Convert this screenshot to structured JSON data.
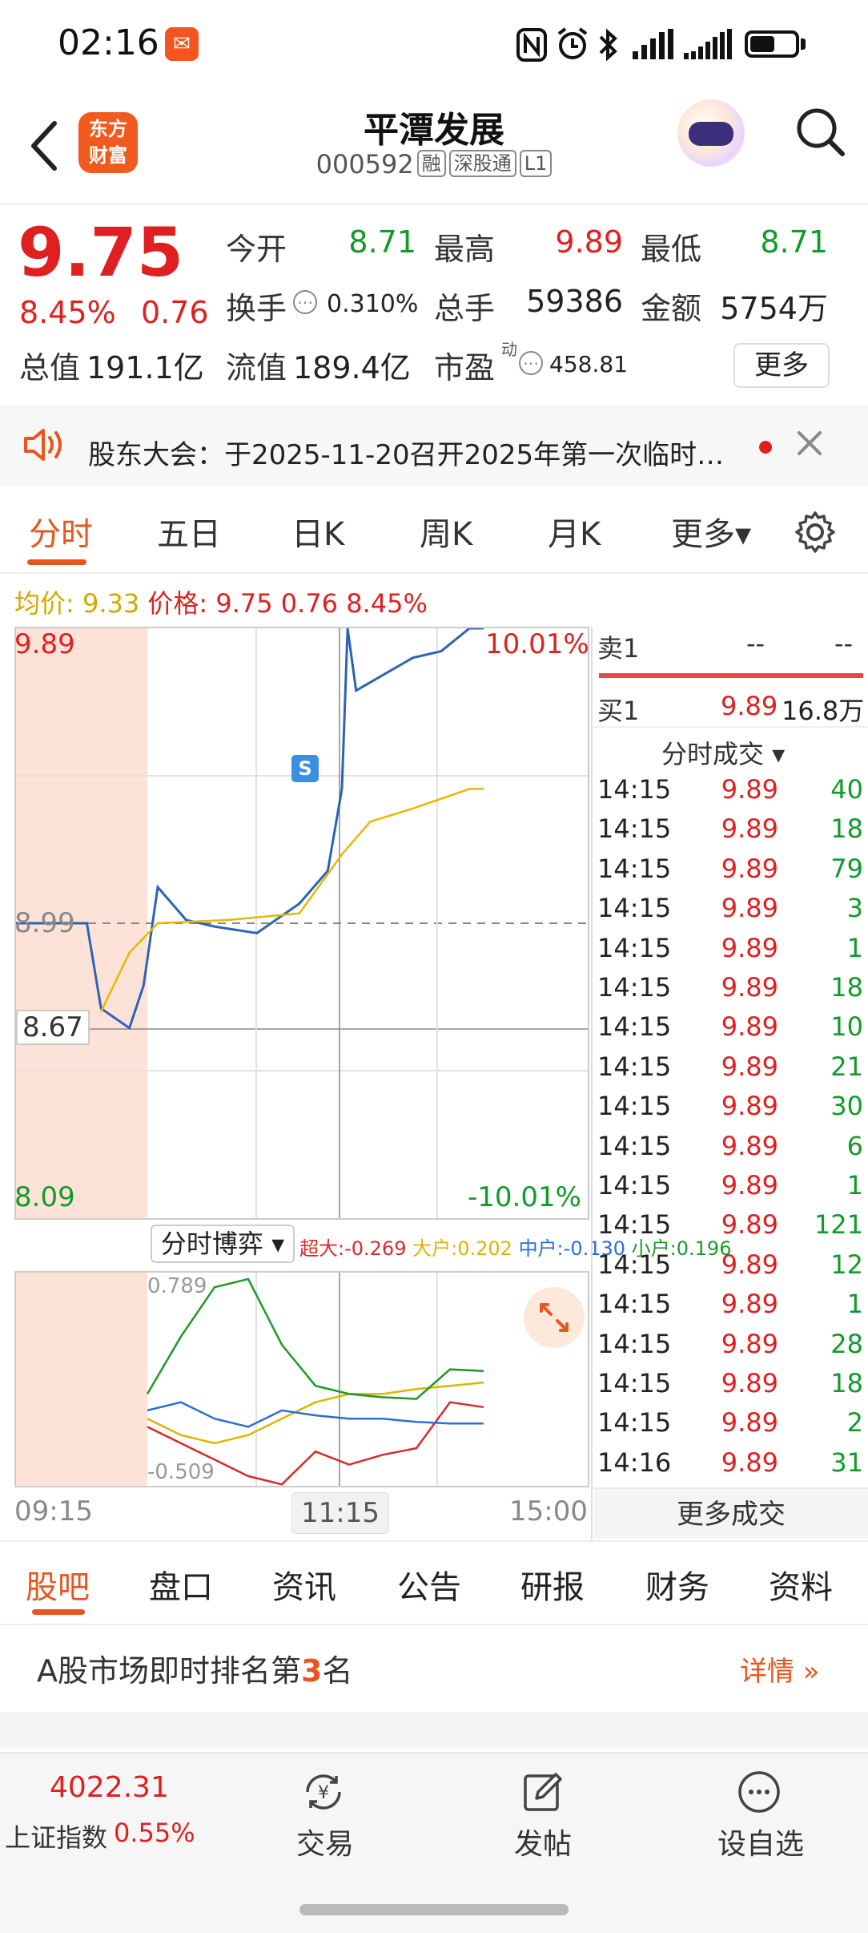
{
  "status_bar": {
    "time": "02:16",
    "icons": [
      "app-notification-icon",
      "nfc-icon",
      "alarm-icon",
      "bluetooth-icon",
      "signal-icon",
      "signal-icon-2",
      "battery-icon"
    ]
  },
  "header": {
    "app_logo_line1": "东方",
    "app_logo_line2": "财富",
    "stock_name": "平潭发展",
    "stock_code": "000592",
    "tags": [
      "融",
      "深股通",
      "L1"
    ]
  },
  "quote": {
    "price": "9.75",
    "change_pct": "8.45%",
    "change_amt": "0.76",
    "fields": {
      "open_label": "今开",
      "open_value": "8.71",
      "high_label": "最高",
      "high_value": "9.89",
      "low_label": "最低",
      "low_value": "8.71",
      "turnover_label": "换手",
      "turnover_value": "0.310%",
      "volume_label": "总手",
      "volume_value": "59386",
      "amount_label": "金额",
      "amount_value": "5754万",
      "mktcap_label": "总值",
      "mktcap_value": "191.1亿",
      "float_label": "流值",
      "float_value": "189.4亿",
      "pe_label": "市盈",
      "pe_sup": "动",
      "pe_value": "458.81"
    },
    "more_button": "更多"
  },
  "notice": {
    "text": "股东大会：于2025-11-20召开2025年第一次临时…"
  },
  "chart_tabs": {
    "tabs": [
      "分时",
      "五日",
      "日K",
      "周K",
      "月K",
      "更多▾"
    ],
    "active": 0
  },
  "intraday": {
    "avg_label": "均价:",
    "avg_value": "9.33",
    "price_label": "价格:",
    "price_value": "9.75 0.76 8.45%",
    "y_top": "9.89",
    "y_mid": "8.99",
    "y_cursor": "8.67",
    "y_bottom": "8.09",
    "pct_top": "10.01%",
    "pct_bottom": "-10.01%",
    "signal_marker": "S",
    "sub_select": "分时博弈",
    "flow_legend": [
      {
        "label": "超大:",
        "value": "-0.269",
        "color": "#d62b2b"
      },
      {
        "label": "大户:",
        "value": "0.202",
        "color": "#e0b400"
      },
      {
        "label": "中户:",
        "value": "-0.130",
        "color": "#2a6fd6"
      },
      {
        "label": "小户:",
        "value": "0.196",
        "color": "#1c9a2a"
      }
    ],
    "sub_top": "0.789",
    "sub_bottom": "-0.509",
    "time_start": "09:15",
    "time_mid": "11:15",
    "time_end": "15:00"
  },
  "chart_data": [
    {
      "type": "line",
      "title": "",
      "x_range": [
        "09:15",
        "15:00"
      ],
      "ylim": [
        8.09,
        9.89
      ],
      "reference_price": 8.99,
      "series": [
        {
          "name": "价格",
          "color": "#2b63b8",
          "x": [
            "09:15",
            "09:30",
            "09:40",
            "09:45",
            "09:55",
            "10:00",
            "10:05",
            "10:15",
            "10:25",
            "10:40",
            "10:55",
            "11:05",
            "11:10",
            "11:12",
            "11:15",
            "11:25",
            "11:35",
            "11:45",
            "11:55",
            "12:00"
          ],
          "values": [
            8.99,
            8.99,
            8.99,
            8.73,
            8.67,
            8.8,
            9.1,
            9.0,
            8.98,
            8.96,
            9.05,
            9.15,
            9.4,
            9.89,
            9.7,
            9.75,
            9.8,
            9.82,
            9.89,
            9.89
          ]
        },
        {
          "name": "均价",
          "color": "#e6b800",
          "x": [
            "09:45",
            "09:55",
            "10:05",
            "10:30",
            "10:55",
            "11:10",
            "11:20",
            "11:35",
            "11:55",
            "12:00"
          ],
          "values": [
            8.72,
            8.9,
            8.99,
            9.0,
            9.02,
            9.2,
            9.3,
            9.34,
            9.4,
            9.4
          ]
        }
      ]
    },
    {
      "type": "line",
      "title": "分时博弈",
      "ylim": [
        -0.509,
        0.789
      ],
      "series": [
        {
          "name": "超大",
          "color": "#d62b2b",
          "values": [
            -0.15,
            -0.25,
            -0.35,
            -0.45,
            -0.5,
            -0.3,
            -0.38,
            -0.32,
            -0.28,
            0.0,
            -0.03
          ]
        },
        {
          "name": "大户",
          "color": "#e0b400",
          "values": [
            -0.1,
            -0.2,
            -0.25,
            -0.2,
            -0.1,
            0.0,
            0.05,
            0.05,
            0.08,
            0.1,
            0.12
          ]
        },
        {
          "name": "中户",
          "color": "#2a6fd6",
          "values": [
            -0.05,
            0.0,
            -0.1,
            -0.15,
            -0.05,
            -0.08,
            -0.1,
            -0.1,
            -0.12,
            -0.13,
            -0.13
          ]
        },
        {
          "name": "小户",
          "color": "#1c9a2a",
          "values": [
            0.05,
            0.4,
            0.7,
            0.75,
            0.35,
            0.1,
            0.05,
            0.03,
            0.02,
            0.2,
            0.19
          ]
        }
      ]
    }
  ],
  "order_book": {
    "sell1_label": "卖1",
    "sell1_price": "--",
    "sell1_vol": "--",
    "buy1_label": "买1",
    "buy1_price": "9.89",
    "buy1_vol": "16.8万"
  },
  "ticks": {
    "title": "分时成交 ▾",
    "rows": [
      {
        "time": "14:15",
        "price": "9.89",
        "vol": "40"
      },
      {
        "time": "14:15",
        "price": "9.89",
        "vol": "18"
      },
      {
        "time": "14:15",
        "price": "9.89",
        "vol": "79"
      },
      {
        "time": "14:15",
        "price": "9.89",
        "vol": "3"
      },
      {
        "time": "14:15",
        "price": "9.89",
        "vol": "1"
      },
      {
        "time": "14:15",
        "price": "9.89",
        "vol": "18"
      },
      {
        "time": "14:15",
        "price": "9.89",
        "vol": "10"
      },
      {
        "time": "14:15",
        "price": "9.89",
        "vol": "21"
      },
      {
        "time": "14:15",
        "price": "9.89",
        "vol": "30"
      },
      {
        "time": "14:15",
        "price": "9.89",
        "vol": "6"
      },
      {
        "time": "14:15",
        "price": "9.89",
        "vol": "1"
      },
      {
        "time": "14:15",
        "price": "9.89",
        "vol": "121"
      },
      {
        "time": "14:15",
        "price": "9.89",
        "vol": "12"
      },
      {
        "time": "14:15",
        "price": "9.89",
        "vol": "1"
      },
      {
        "time": "14:15",
        "price": "9.89",
        "vol": "28"
      },
      {
        "time": "14:15",
        "price": "9.89",
        "vol": "18"
      },
      {
        "time": "14:15",
        "price": "9.89",
        "vol": "2"
      },
      {
        "time": "14:16",
        "price": "9.89",
        "vol": "31"
      }
    ],
    "more_label": "更多成交"
  },
  "bottom_tabs": {
    "tabs": [
      "股吧",
      "盘口",
      "资讯",
      "公告",
      "研报",
      "财务",
      "资料"
    ],
    "active": 0
  },
  "rank": {
    "prefix": "A股市场即时排名第",
    "number": "3",
    "suffix": "名",
    "detail": "详情 »"
  },
  "bottom_nav": {
    "index_value": "4022.31",
    "index_name": "上证指数",
    "index_pct": "0.55%",
    "trade_label": "交易",
    "post_label": "发帖",
    "watch_label": "设自选"
  }
}
